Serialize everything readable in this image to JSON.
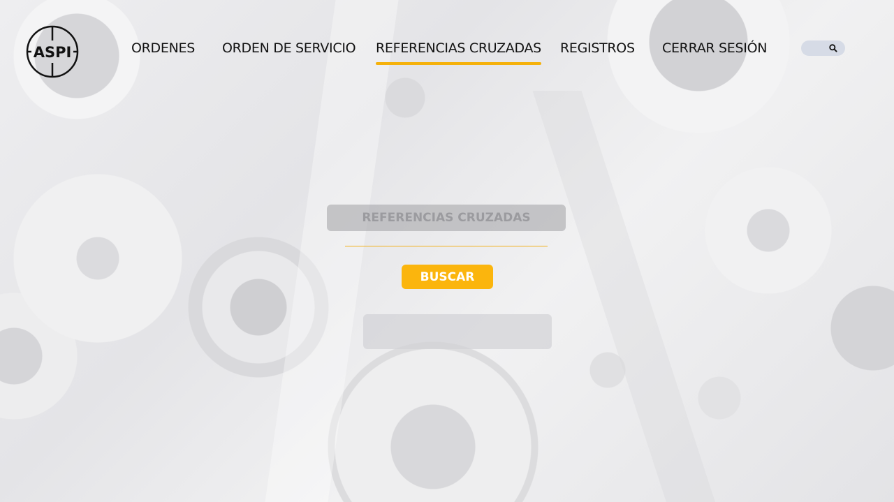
{
  "brand": {
    "logo_text": "ASPI"
  },
  "nav": {
    "items": [
      {
        "label": "ORDENES",
        "active": false
      },
      {
        "label": "ORDEN DE SERVICIO",
        "active": false
      },
      {
        "label": "REFERENCIAS CRUZADAS",
        "active": true
      },
      {
        "label": "REGISTROS",
        "active": false
      },
      {
        "label": "CERRAR SESIÓN",
        "active": false
      }
    ]
  },
  "search": {
    "icon": "search-icon",
    "placeholder": ""
  },
  "form": {
    "input_placeholder": "REFERENCIAS CRUZADAS",
    "input_value": "",
    "submit_label": "BUSCAR"
  },
  "colors": {
    "accent": "#fbb50d",
    "underline": "#f2b01a",
    "search_pill": "#d6dbe6",
    "nav_text": "#111111"
  }
}
